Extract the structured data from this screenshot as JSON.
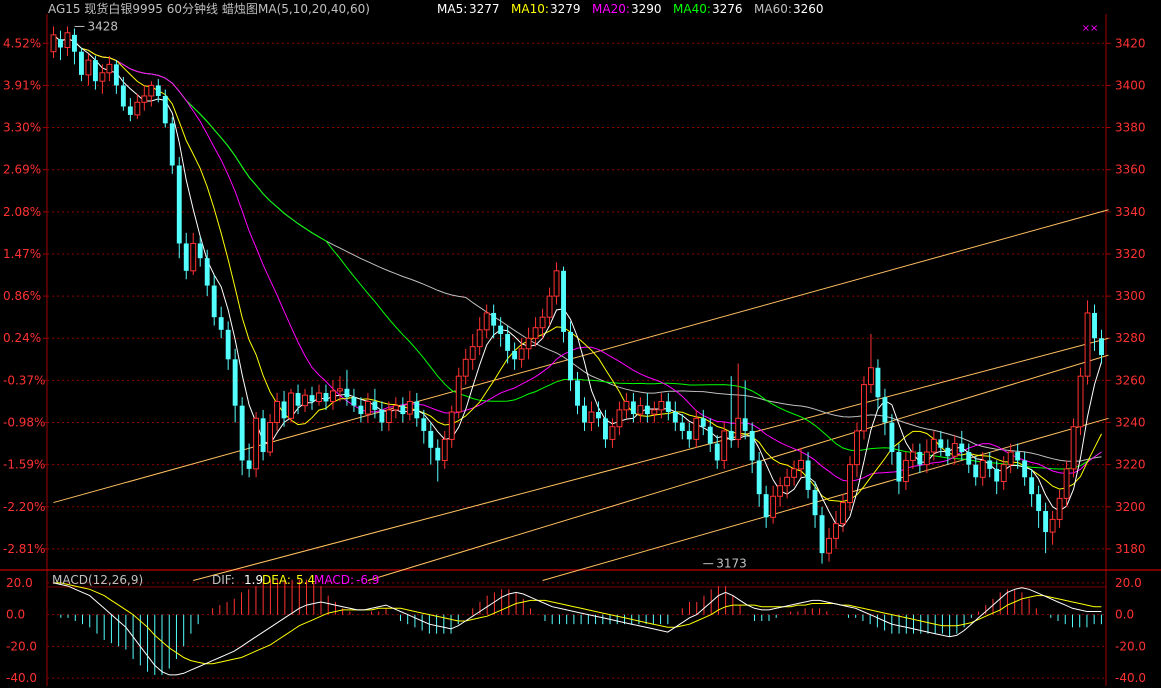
{
  "header": {
    "title": "AG15 现货白银9995 60分钟线  蜡烛图",
    "ma_label": "MA(5,10,20,40,60)",
    "ma_values": [
      {
        "name": "MA5:",
        "value": "3277",
        "color": "#ffffff"
      },
      {
        "name": "MA10:",
        "value": "3279",
        "color": "#ffff00"
      },
      {
        "name": "MA20:",
        "value": "3290",
        "color": "#ff00ff"
      },
      {
        "name": "MA40:",
        "value": "3276",
        "color": "#00ff00"
      },
      {
        "name": "MA60:",
        "value": "3260",
        "color": "#c0c0c0"
      }
    ],
    "corner_mark": "××"
  },
  "colors": {
    "up": "#ff3232",
    "down": "#54ffff",
    "grid": "#8b0000",
    "frame": "#a00000",
    "ma5": "#ffffff",
    "ma10": "#ffff00",
    "ma20": "#ff00ff",
    "ma40": "#00ff00",
    "ma60": "#c0c0c0",
    "channel": "#ffc060",
    "dif": "#ffffff",
    "dea": "#ffff00",
    "macd": "#ff00ff"
  },
  "chart_data": [
    {
      "type": "candlestick",
      "name": "price",
      "ylim": [
        3170,
        3432
      ],
      "right_ticks": [
        3420,
        3400,
        3380,
        3360,
        3340,
        3320,
        3300,
        3280,
        3260,
        3240,
        3220,
        3200,
        3180
      ],
      "left_ticks": [
        "4.52%",
        "3.91%",
        "3.30%",
        "2.69%",
        "2.08%",
        "1.47%",
        "0.86%",
        "0.24%",
        "-0.37%",
        "-0.98%",
        "-1.59%",
        "-2.20%",
        "-2.81%"
      ],
      "annotations": [
        {
          "text": "3428",
          "value": 3428,
          "index": 3
        },
        {
          "text": "3173",
          "value": 3173,
          "index": 93
        }
      ],
      "channel_lines": [
        {
          "start": [
            0,
            3202
          ],
          "end": [
            151,
            3341
          ]
        },
        {
          "start": [
            20,
            3165
          ],
          "end": [
            151,
            3280
          ]
        },
        {
          "start": [
            45,
            3165
          ],
          "end": [
            151,
            3272
          ]
        },
        {
          "start": [
            70,
            3165
          ],
          "end": [
            151,
            3242
          ]
        }
      ],
      "candles": [
        [
          3416,
          3424,
          3428,
          3413
        ],
        [
          3422,
          3418,
          3426,
          3412
        ],
        [
          3418,
          3425,
          3428,
          3414
        ],
        [
          3424,
          3416,
          3427,
          3410
        ],
        [
          3416,
          3405,
          3418,
          3402
        ],
        [
          3405,
          3412,
          3415,
          3400
        ],
        [
          3412,
          3402,
          3414,
          3398
        ],
        [
          3402,
          3406,
          3410,
          3396
        ],
        [
          3406,
          3410,
          3414,
          3402
        ],
        [
          3410,
          3400,
          3412,
          3396
        ],
        [
          3400,
          3390,
          3404,
          3388
        ],
        [
          3390,
          3386,
          3394,
          3383
        ],
        [
          3386,
          3392,
          3396,
          3384
        ],
        [
          3392,
          3395,
          3400,
          3388
        ],
        [
          3395,
          3400,
          3402,
          3390
        ],
        [
          3400,
          3395,
          3403,
          3392
        ],
        [
          3395,
          3382,
          3398,
          3380
        ],
        [
          3382,
          3362,
          3385,
          3358
        ],
        [
          3362,
          3325,
          3366,
          3318
        ],
        [
          3325,
          3312,
          3330,
          3308
        ],
        [
          3312,
          3325,
          3330,
          3310
        ],
        [
          3325,
          3318,
          3328,
          3314
        ],
        [
          3318,
          3305,
          3322,
          3300
        ],
        [
          3305,
          3290,
          3310,
          3286
        ],
        [
          3290,
          3284,
          3295,
          3280
        ],
        [
          3284,
          3270,
          3288,
          3265
        ],
        [
          3270,
          3248,
          3275,
          3240
        ],
        [
          3248,
          3222,
          3252,
          3215
        ],
        [
          3222,
          3218,
          3230,
          3214
        ],
        [
          3218,
          3242,
          3245,
          3214
        ],
        [
          3242,
          3226,
          3246,
          3222
        ],
        [
          3226,
          3240,
          3244,
          3224
        ],
        [
          3240,
          3250,
          3254,
          3236
        ],
        [
          3250,
          3242,
          3255,
          3238
        ],
        [
          3242,
          3254,
          3256,
          3240
        ],
        [
          3254,
          3248,
          3258,
          3244
        ],
        [
          3248,
          3253,
          3256,
          3245
        ],
        [
          3253,
          3250,
          3257,
          3246
        ],
        [
          3250,
          3254,
          3258,
          3248
        ],
        [
          3254,
          3250,
          3258,
          3246
        ],
        [
          3250,
          3255,
          3260,
          3246
        ],
        [
          3255,
          3256,
          3262,
          3250
        ],
        [
          3256,
          3252,
          3265,
          3248
        ],
        [
          3252,
          3248,
          3256,
          3245
        ],
        [
          3248,
          3244,
          3252,
          3240
        ],
        [
          3244,
          3250,
          3254,
          3240
        ],
        [
          3250,
          3246,
          3256,
          3242
        ],
        [
          3246,
          3240,
          3250,
          3236
        ],
        [
          3240,
          3246,
          3250,
          3236
        ],
        [
          3246,
          3248,
          3252,
          3242
        ],
        [
          3248,
          3244,
          3252,
          3240
        ],
        [
          3244,
          3250,
          3255,
          3241
        ],
        [
          3250,
          3242,
          3254,
          3238
        ],
        [
          3242,
          3236,
          3246,
          3230
        ],
        [
          3236,
          3228,
          3240,
          3220
        ],
        [
          3228,
          3222,
          3232,
          3212
        ],
        [
          3222,
          3232,
          3236,
          3218
        ],
        [
          3232,
          3245,
          3248,
          3228
        ],
        [
          3245,
          3262,
          3266,
          3242
        ],
        [
          3262,
          3270,
          3275,
          3258
        ],
        [
          3270,
          3276,
          3282,
          3265
        ],
        [
          3276,
          3284,
          3290,
          3272
        ],
        [
          3284,
          3292,
          3296,
          3280
        ],
        [
          3292,
          3286,
          3296,
          3280
        ],
        [
          3286,
          3282,
          3290,
          3276
        ],
        [
          3282,
          3274,
          3286,
          3268
        ],
        [
          3274,
          3270,
          3278,
          3265
        ],
        [
          3270,
          3275,
          3280,
          3266
        ],
        [
          3275,
          3280,
          3285,
          3270
        ],
        [
          3280,
          3285,
          3290,
          3276
        ],
        [
          3285,
          3290,
          3294,
          3280
        ],
        [
          3290,
          3300,
          3304,
          3286
        ],
        [
          3300,
          3312,
          3316,
          3296
        ],
        [
          3312,
          3283,
          3314,
          3278
        ],
        [
          3283,
          3260,
          3288,
          3255
        ],
        [
          3260,
          3248,
          3264,
          3244
        ],
        [
          3248,
          3240,
          3252,
          3236
        ],
        [
          3240,
          3245,
          3250,
          3236
        ],
        [
          3245,
          3242,
          3250,
          3238
        ],
        [
          3242,
          3232,
          3246,
          3228
        ],
        [
          3232,
          3238,
          3242,
          3228
        ],
        [
          3238,
          3246,
          3250,
          3234
        ],
        [
          3246,
          3250,
          3254,
          3242
        ],
        [
          3250,
          3244,
          3254,
          3240
        ],
        [
          3244,
          3248,
          3252,
          3240
        ],
        [
          3248,
          3244,
          3254,
          3240
        ],
        [
          3244,
          3246,
          3250,
          3240
        ],
        [
          3246,
          3250,
          3254,
          3242
        ],
        [
          3250,
          3245,
          3254,
          3241
        ],
        [
          3245,
          3240,
          3250,
          3236
        ],
        [
          3240,
          3236,
          3244,
          3232
        ],
        [
          3236,
          3232,
          3240,
          3228
        ],
        [
          3232,
          3242,
          3246,
          3228
        ],
        [
          3242,
          3238,
          3246,
          3234
        ],
        [
          3238,
          3230,
          3242,
          3226
        ],
        [
          3230,
          3222,
          3234,
          3218
        ],
        [
          3222,
          3236,
          3240,
          3218
        ],
        [
          3236,
          3232,
          3262,
          3228
        ],
        [
          3232,
          3242,
          3268,
          3228
        ],
        [
          3242,
          3236,
          3260,
          3232
        ],
        [
          3236,
          3222,
          3240,
          3216
        ],
        [
          3222,
          3206,
          3226,
          3200
        ],
        [
          3206,
          3195,
          3210,
          3190
        ],
        [
          3195,
          3205,
          3210,
          3192
        ],
        [
          3205,
          3210,
          3214,
          3200
        ],
        [
          3210,
          3214,
          3218,
          3204
        ],
        [
          3214,
          3218,
          3222,
          3210
        ],
        [
          3218,
          3222,
          3228,
          3214
        ],
        [
          3222,
          3208,
          3226,
          3204
        ],
        [
          3208,
          3196,
          3212,
          3190
        ],
        [
          3196,
          3178,
          3200,
          3173
        ],
        [
          3178,
          3185,
          3190,
          3174
        ],
        [
          3185,
          3192,
          3198,
          3180
        ],
        [
          3192,
          3202,
          3206,
          3188
        ],
        [
          3202,
          3220,
          3224,
          3198
        ],
        [
          3220,
          3236,
          3240,
          3214
        ],
        [
          3236,
          3258,
          3262,
          3232
        ],
        [
          3258,
          3266,
          3282,
          3254
        ],
        [
          3266,
          3252,
          3270,
          3246
        ],
        [
          3252,
          3240,
          3256,
          3234
        ],
        [
          3240,
          3226,
          3244,
          3220
        ],
        [
          3226,
          3212,
          3230,
          3206
        ],
        [
          3212,
          3222,
          3226,
          3208
        ],
        [
          3222,
          3226,
          3230,
          3218
        ],
        [
          3226,
          3220,
          3230,
          3216
        ],
        [
          3220,
          3226,
          3232,
          3216
        ],
        [
          3226,
          3232,
          3236,
          3222
        ],
        [
          3232,
          3228,
          3236,
          3224
        ],
        [
          3228,
          3224,
          3232,
          3220
        ],
        [
          3224,
          3230,
          3234,
          3220
        ],
        [
          3230,
          3226,
          3236,
          3222
        ],
        [
          3226,
          3220,
          3230,
          3216
        ],
        [
          3220,
          3214,
          3224,
          3210
        ],
        [
          3214,
          3222,
          3226,
          3210
        ],
        [
          3222,
          3218,
          3226,
          3214
        ],
        [
          3218,
          3212,
          3222,
          3206
        ],
        [
          3212,
          3220,
          3224,
          3208
        ],
        [
          3220,
          3226,
          3230,
          3216
        ],
        [
          3226,
          3222,
          3230,
          3218
        ],
        [
          3222,
          3214,
          3226,
          3210
        ],
        [
          3214,
          3206,
          3218,
          3200
        ],
        [
          3206,
          3198,
          3210,
          3190
        ],
        [
          3198,
          3188,
          3202,
          3178
        ],
        [
          3188,
          3194,
          3198,
          3182
        ],
        [
          3194,
          3204,
          3208,
          3190
        ],
        [
          3204,
          3218,
          3222,
          3200
        ],
        [
          3218,
          3238,
          3242,
          3214
        ],
        [
          3238,
          3262,
          3266,
          3234
        ],
        [
          3262,
          3292,
          3298,
          3258
        ],
        [
          3292,
          3280,
          3296,
          3274
        ],
        [
          3280,
          3272,
          3284,
          3268
        ]
      ]
    },
    {
      "type": "bar",
      "name": "MACD",
      "label": "MACD(12,26,9)",
      "dif_label": "DIF:",
      "dif_value": "1.9",
      "dea_label": "DEA:",
      "dea_value": "5.4",
      "macd_label": "MACD:",
      "macd_value": "-6.9",
      "ylim": [
        -45,
        25
      ],
      "ticks": [
        20.0,
        0.0,
        -20.0,
        -40.0
      ],
      "dif": [
        20,
        19,
        18,
        16,
        14,
        12,
        8,
        4,
        0,
        -4,
        -8,
        -14,
        -20,
        -26,
        -32,
        -36,
        -38,
        -38,
        -37,
        -35,
        -33,
        -31,
        -29,
        -27,
        -25,
        -23,
        -20,
        -17,
        -14,
        -11,
        -8,
        -5,
        -2,
        1,
        4,
        6,
        7,
        8,
        7,
        6,
        5,
        4,
        3,
        3,
        4,
        5,
        6,
        4,
        2,
        0,
        -2,
        -4,
        -6,
        -7,
        -8,
        -9,
        -7,
        -4,
        -1,
        2,
        5,
        8,
        11,
        13,
        14,
        13,
        11,
        9,
        7,
        5,
        4,
        3,
        2,
        1,
        0,
        -1,
        -2,
        -3,
        -4,
        -5,
        -6,
        -7,
        -8,
        -9,
        -10,
        -11,
        -8,
        -5,
        -2,
        0,
        4,
        8,
        12,
        14,
        12,
        9,
        6,
        4,
        3,
        3,
        4,
        5,
        6,
        7,
        8,
        9,
        9,
        8,
        7,
        6,
        5,
        4,
        2,
        0,
        -2,
        -4,
        -6,
        -7,
        -8,
        -9,
        -10,
        -11,
        -12,
        -13,
        -14,
        -13,
        -10,
        -6,
        -2,
        2,
        6,
        10,
        14,
        16,
        17,
        16,
        14,
        12,
        10,
        8,
        6,
        4,
        3,
        2,
        2,
        2
      ],
      "dea": [
        20,
        20,
        19,
        18,
        17,
        16,
        14,
        12,
        9,
        6,
        3,
        0,
        -4,
        -8,
        -13,
        -17,
        -21,
        -24,
        -27,
        -29,
        -30,
        -31,
        -31,
        -30,
        -29,
        -28,
        -27,
        -25,
        -23,
        -21,
        -19,
        -16,
        -13,
        -10,
        -7,
        -5,
        -3,
        -1,
        1,
        2,
        3,
        3,
        3,
        3,
        3,
        4,
        4,
        4,
        4,
        3,
        2,
        1,
        0,
        -1,
        -2,
        -3,
        -4,
        -4,
        -3,
        -2,
        -1,
        1,
        3,
        5,
        7,
        8,
        9,
        9,
        9,
        8,
        7,
        6,
        5,
        4,
        3,
        2,
        1,
        0,
        -1,
        -2,
        -3,
        -4,
        -5,
        -6,
        -7,
        -8,
        -8,
        -7,
        -6,
        -4,
        -2,
        0,
        3,
        5,
        6,
        6,
        6,
        6,
        5,
        5,
        5,
        5,
        5,
        6,
        6,
        7,
        7,
        7,
        7,
        6,
        6,
        5,
        4,
        3,
        2,
        1,
        0,
        -1,
        -2,
        -3,
        -4,
        -5,
        -6,
        -7,
        -7,
        -7,
        -6,
        -5,
        -3,
        -1,
        1,
        3,
        6,
        8,
        10,
        11,
        12,
        12,
        11,
        10,
        9,
        8,
        7,
        6,
        5,
        5
      ]
    }
  ]
}
